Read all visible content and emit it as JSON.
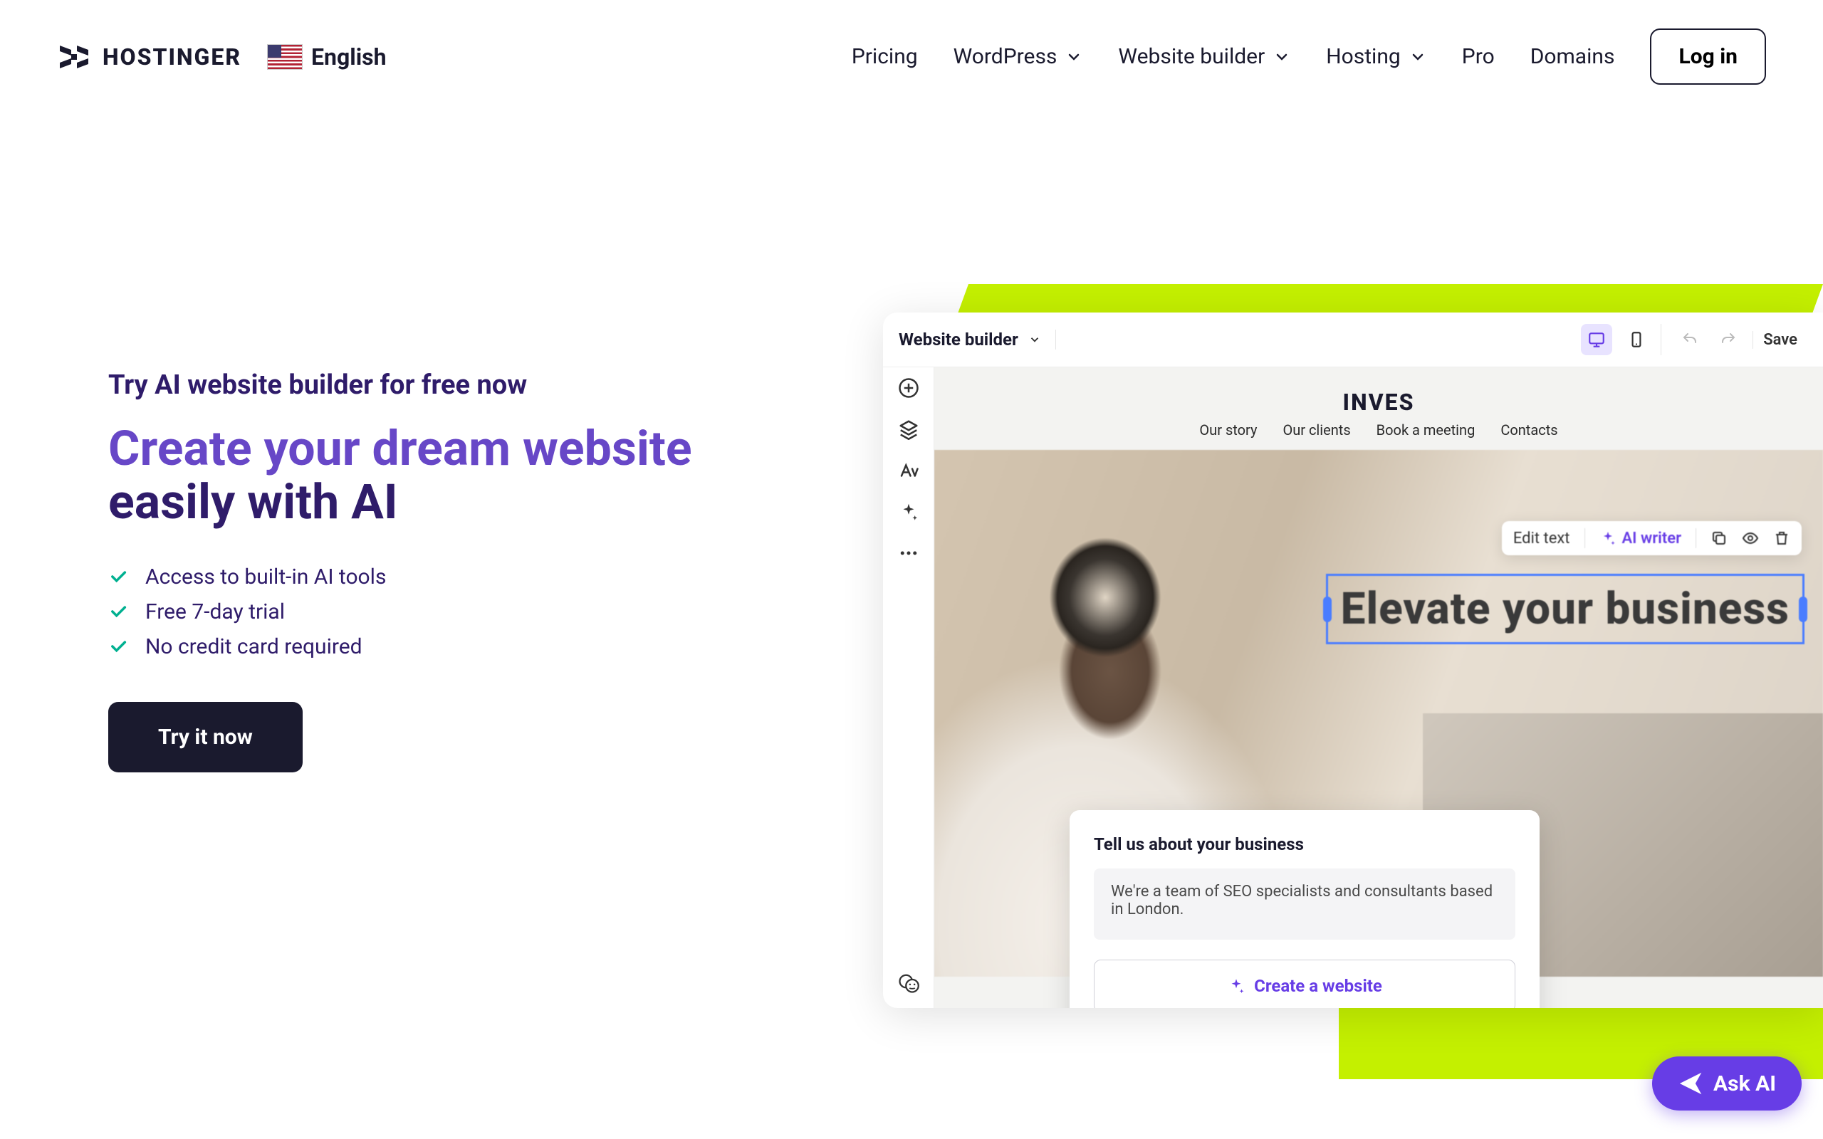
{
  "header": {
    "brand": "HOSTINGER",
    "language": "English",
    "nav": {
      "pricing": "Pricing",
      "wordpress": "WordPress",
      "builder": "Website builder",
      "hosting": "Hosting",
      "pro": "Pro",
      "domains": "Domains"
    },
    "login": "Log in"
  },
  "hero": {
    "eyebrow": "Try AI website builder for free now",
    "headline_accent": "Create your dream website",
    "headline_rest": " easily with AI",
    "benefits": [
      "Access to built-in AI tools",
      "Free 7-day trial",
      "No credit card required"
    ],
    "cta": "Try it now"
  },
  "builder": {
    "title": "Website builder",
    "save": "Save",
    "canvas": {
      "brand": "INVES",
      "nav": [
        "Our story",
        "Our clients",
        "Book a meeting",
        "Contacts"
      ],
      "heading": "Elevate your business"
    },
    "toolbar": {
      "edit": "Edit text",
      "ai": "AI writer"
    },
    "modal": {
      "title": "Tell us about your business",
      "text": "We're a team of SEO specialists and consultants based in London.",
      "button": "Create a website"
    }
  },
  "ask_ai": "Ask AI"
}
